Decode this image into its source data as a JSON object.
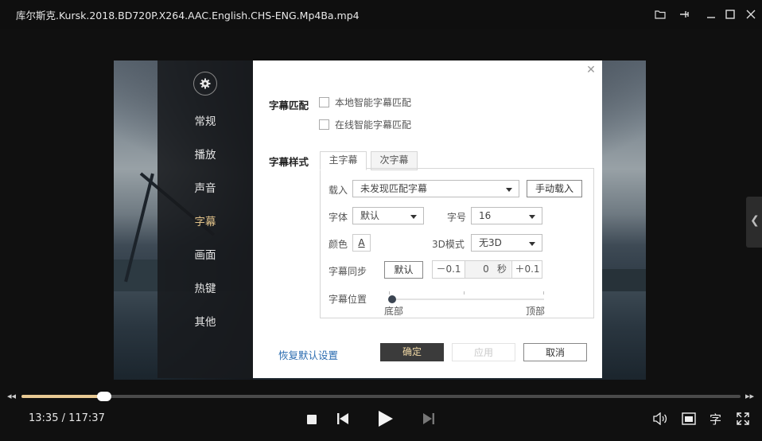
{
  "window": {
    "title": "库尔斯克.Kursk.2018.BD720P.X264.AAC.English.CHS-ENG.Mp4Ba.mp4",
    "buttons": [
      "folder-icon",
      "pin-icon",
      "minimize-icon",
      "maximize-icon",
      "close-icon"
    ]
  },
  "settings": {
    "sidebar": {
      "icon": "gear-icon",
      "items": [
        "常规",
        "播放",
        "声音",
        "字幕",
        "画面",
        "热键",
        "其他"
      ],
      "active": "字幕"
    },
    "match": {
      "label": "字幕匹配",
      "local": "本地智能字幕匹配",
      "online": "在线智能字幕匹配"
    },
    "style": {
      "label": "字幕样式",
      "tabs": [
        "主字幕",
        "次字幕"
      ],
      "active_tab": "主字幕",
      "load_label": "载入",
      "load_value": "未发现匹配字幕",
      "manual_load": "手动载入",
      "font_label": "字体",
      "font_value": "默认",
      "size_label": "字号",
      "size_value": "16",
      "color_label": "颜色",
      "color_glyph": "A",
      "mode3d_label": "3D模式",
      "mode3d_value": "无3D",
      "sync_label": "字幕同步",
      "sync_default": "默认",
      "sync_minus": "－0.1",
      "sync_value": "0",
      "sync_unit": "秒",
      "sync_plus": "＋0.1",
      "pos_label": "字幕位置",
      "pos_min": "底部",
      "pos_max": "顶部",
      "pos_level": 0.05
    },
    "restore": "恢复默认设置",
    "ok": "确定",
    "apply": "应用",
    "cancel": "取消"
  },
  "player": {
    "current_time": "13:35",
    "total_time": "117:37",
    "time_text": "13:35 / 117:37",
    "progress": 0.115,
    "subtitle_btn": "字"
  },
  "colors": {
    "accent": "#e0c189",
    "progress_fill": "#e8c993",
    "ok_button": "#3b3b3b"
  }
}
